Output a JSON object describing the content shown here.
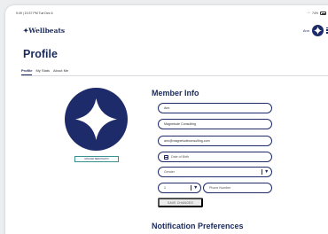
{
  "statusbar": {
    "left": "9:49 | 10:37 PM Tue Dec 6",
    "right": "74%"
  },
  "header": {
    "brand": "✦Wellbeats",
    "user_name": "Ann"
  },
  "page": {
    "title": "Profile"
  },
  "tabs": [
    {
      "label": "Profile",
      "active": true
    },
    {
      "label": "My Stats",
      "active": false
    },
    {
      "label": "About Me",
      "active": false
    }
  ],
  "photo": {
    "upload_label": "UPLOAD NEW PHOTO"
  },
  "member_info": {
    "title": "Member Info",
    "first_name": "Ann",
    "company": "Magnetude Consulting",
    "email": "ann@magnetudeconsulting.com",
    "dob_placeholder": "Date of Birth",
    "gender_placeholder": "Gender",
    "country_code": "1",
    "phone_placeholder": "Phone Number",
    "save_label": "SAVE CHANGES"
  },
  "notifications": {
    "title": "Notification Preferences"
  },
  "colors": {
    "navy": "#1e2b6b",
    "teal": "#3a8f8f"
  }
}
